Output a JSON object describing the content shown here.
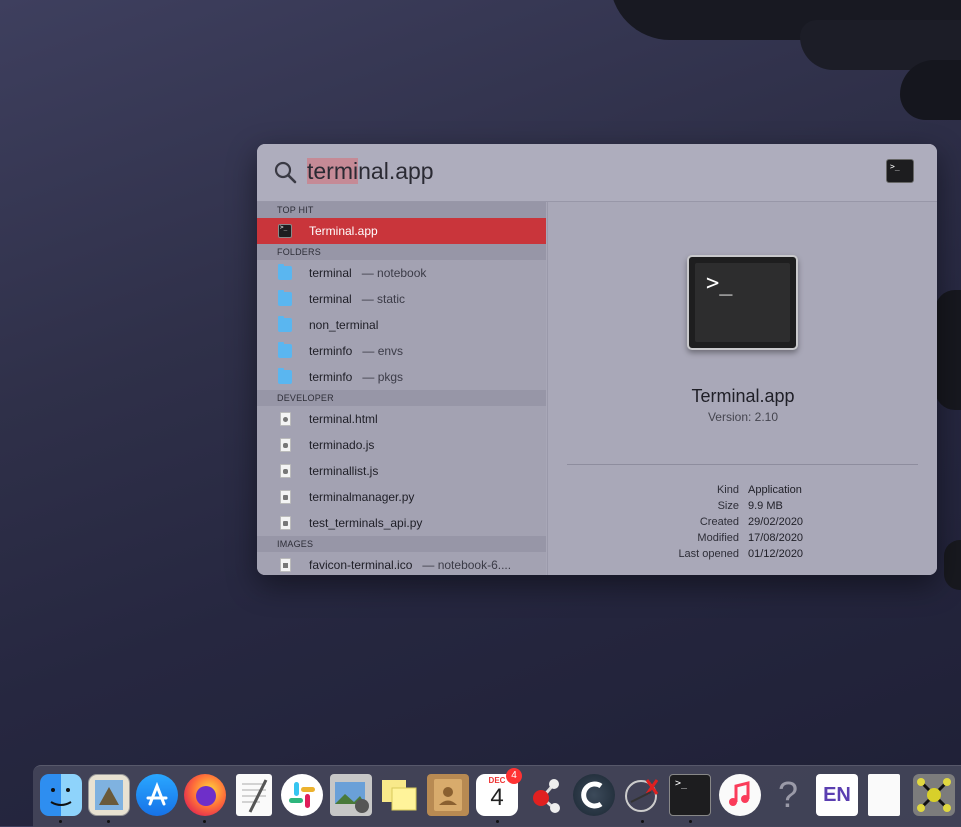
{
  "search": {
    "query_selected": "termi",
    "query_rest": "nal.app"
  },
  "sections": {
    "top_hit": "TOP HIT",
    "folders": "FOLDERS",
    "developer": "DEVELOPER",
    "images": "IMAGES"
  },
  "top_hit": {
    "name": "Terminal.app",
    "icon": "terminal-icon"
  },
  "folders": [
    {
      "name": "terminal",
      "location": "— notebook"
    },
    {
      "name": "terminal",
      "location": "— static"
    },
    {
      "name": "non_terminal",
      "location": ""
    },
    {
      "name": "terminfo",
      "location": "— envs"
    },
    {
      "name": "terminfo",
      "location": "— pkgs"
    }
  ],
  "developer": [
    {
      "name": "terminal.html",
      "type": "html"
    },
    {
      "name": "terminado.js",
      "type": "js"
    },
    {
      "name": "terminallist.js",
      "type": "js"
    },
    {
      "name": "terminalmanager.py",
      "type": "py"
    },
    {
      "name": "test_terminals_api.py",
      "type": "py"
    }
  ],
  "images": [
    {
      "name": "favicon-terminal.ico",
      "location": "— notebook-6...."
    }
  ],
  "preview": {
    "prompt": ">_",
    "title": "Terminal.app",
    "version": "Version: 2.10",
    "meta": [
      {
        "key": "Kind",
        "value": "Application"
      },
      {
        "key": "Size",
        "value": "9.9 MB"
      },
      {
        "key": "Created",
        "value": "29/02/2020"
      },
      {
        "key": "Modified",
        "value": "17/08/2020"
      },
      {
        "key": "Last opened",
        "value": "01/12/2020"
      }
    ]
  },
  "dock": {
    "calendar_month": "DEC",
    "calendar_day": "4",
    "calendar_badge": "4",
    "help_glyph": "?",
    "en_label": "EN",
    "terminal_prompt": ">_",
    "items": [
      "finder-icon",
      "preview-icon",
      "app-store-icon",
      "firefox-icon",
      "textedit-icon",
      "slack-icon",
      "image-capture-icon",
      "stickies-icon",
      "contacts-icon",
      "calendar-icon",
      "molecule-icon",
      "ccleaner-icon",
      "xquartz-icon",
      "terminal-icon",
      "music-icon",
      "help-icon",
      "dictionary-icon",
      "document-icon",
      "app-icon"
    ]
  },
  "colors": {
    "selection": "#c9353b",
    "folder": "#5ab6f0",
    "query_highlight": "#c58a96"
  }
}
